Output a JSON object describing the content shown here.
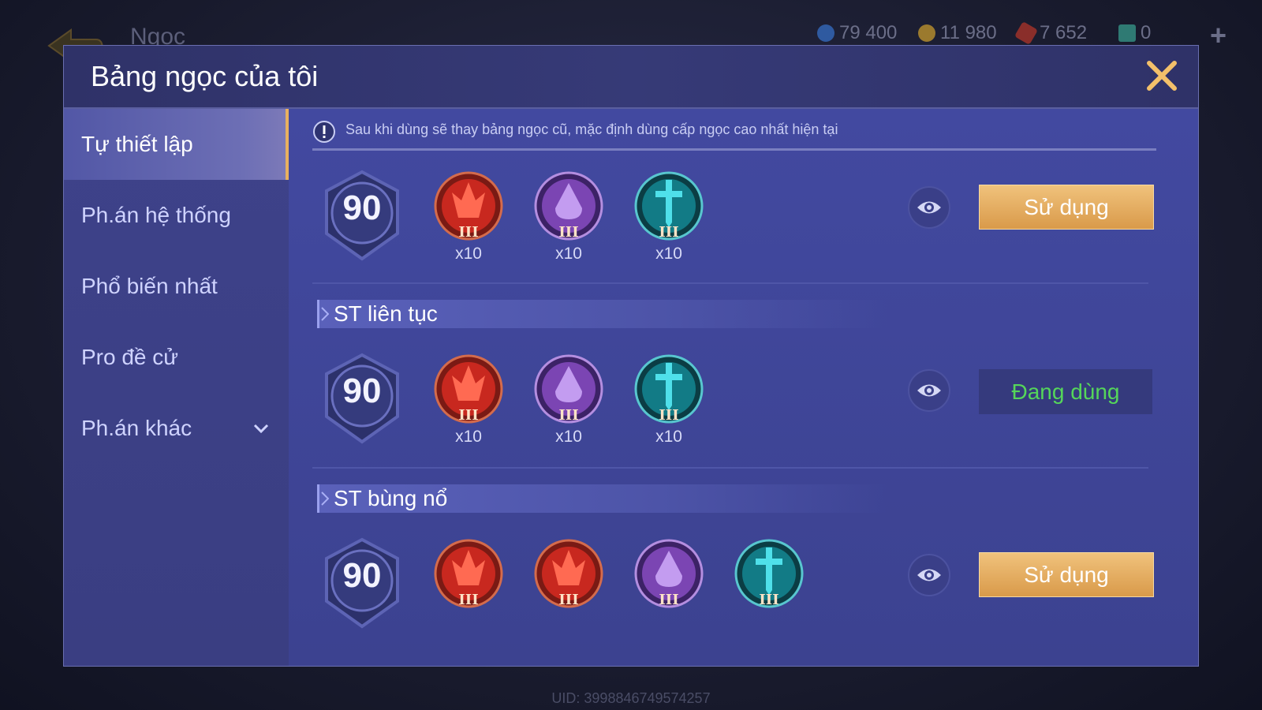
{
  "background": {
    "title": "Ngọc",
    "currencies": [
      {
        "icon": "blue-coin-icon",
        "value": "79 400",
        "color": "#3f7bd6"
      },
      {
        "icon": "gold-coin-icon",
        "value": "11 980",
        "color": "#d9a33a"
      },
      {
        "icon": "red-gem-icon",
        "value": "7 652",
        "color": "#c9403a"
      },
      {
        "icon": "ticket-icon",
        "value": "0",
        "color": "#47b4a8"
      }
    ],
    "uid": "UID: 3998846749574257"
  },
  "modal": {
    "title": "Bảng ngọc của tôi"
  },
  "sidebar": {
    "items": [
      {
        "label": "Tự thiết lập",
        "active": true
      },
      {
        "label": "Ph.án hệ thống"
      },
      {
        "label": "Phổ biến nhất"
      },
      {
        "label": "Pro đề cử"
      },
      {
        "label": "Ph.án khác",
        "icon": "chevron-down-icon"
      }
    ]
  },
  "notice": {
    "icon": "exclamation-icon",
    "text": "Sau khi dùng sẽ thay bảng ngọc cũ, mặc định dùng cấp ngọc cao nhất hiện tại"
  },
  "sets": [
    {
      "level": "90",
      "gems": [
        {
          "type": "red",
          "tier": "III",
          "count": "x10"
        },
        {
          "type": "purple",
          "tier": "III",
          "count": "x10"
        },
        {
          "type": "teal",
          "tier": "III",
          "count": "x10"
        }
      ],
      "action": "Sử dụng"
    },
    {
      "name": "ST liên tục",
      "level": "90",
      "gems": [
        {
          "type": "red",
          "tier": "III",
          "count": "x10"
        },
        {
          "type": "purple",
          "tier": "III",
          "count": "x10"
        },
        {
          "type": "teal",
          "tier": "III",
          "count": "x10"
        }
      ],
      "action": "Đang dùng"
    },
    {
      "name": "ST bùng nổ",
      "level": "90",
      "gems": [
        {
          "type": "red",
          "tier": "III"
        },
        {
          "type": "red",
          "tier": "III"
        },
        {
          "type": "purple",
          "tier": "III"
        },
        {
          "type": "teal",
          "tier": "III"
        }
      ],
      "action": "Sử dụng"
    }
  ],
  "colors": {
    "accent": "#e8b060",
    "in_use": "#55d65a",
    "gem_red": "#c8281f",
    "gem_purple": "#7b45b3",
    "gem_teal": "#127b86"
  }
}
